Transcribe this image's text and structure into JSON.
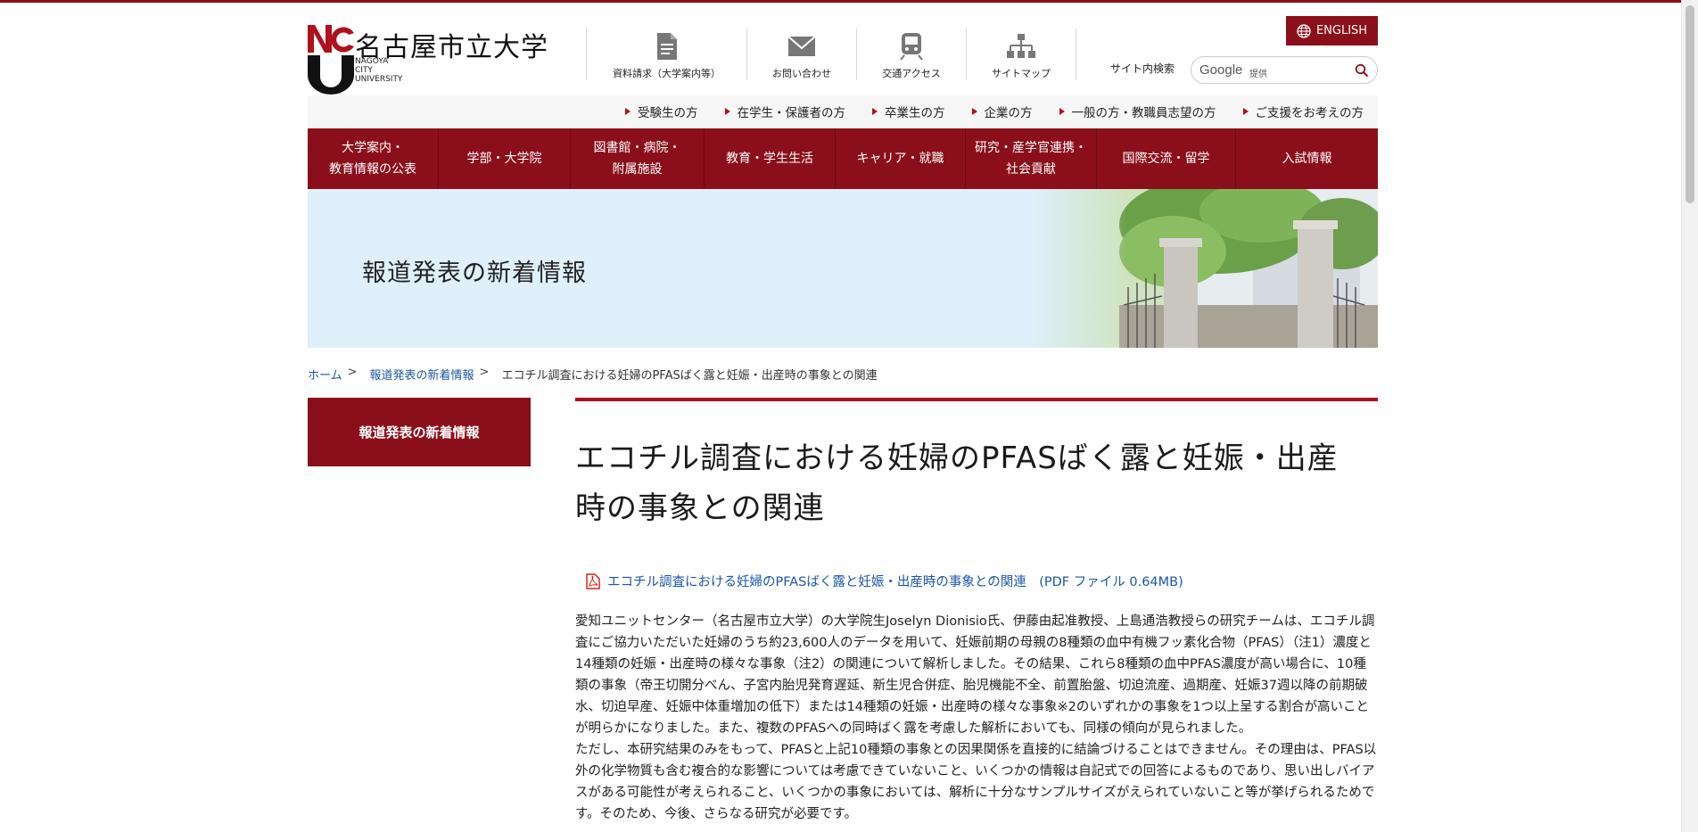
{
  "header": {
    "logo_jp": "名古屋市立大学",
    "logo_en_lines": [
      "NAGOYA",
      "CITY",
      "UNIVERSITY"
    ],
    "english_label": "ENGLISH",
    "util": [
      {
        "label": "資料請求（大学案内等）",
        "icon": "document-icon"
      },
      {
        "label": "お問い合わせ",
        "icon": "mail-icon"
      },
      {
        "label": "交通アクセス",
        "icon": "train-icon"
      },
      {
        "label": "サイトマップ",
        "icon": "sitemap-icon"
      }
    ],
    "search_label": "サイト内検索",
    "search_google": "Google",
    "search_provided": "提供"
  },
  "audience_nav": [
    "受験生の方",
    "在学生・保護者の方",
    "卒業生の方",
    "企業の方",
    "一般の方・教職員志望の方",
    "ご支援をお考えの方"
  ],
  "global_nav": [
    {
      "line1": "大学案内・",
      "line2": "教育情報の公表"
    },
    {
      "line1": "学部・大学院",
      "line2": ""
    },
    {
      "line1": "図書館・病院・",
      "line2": "附属施設"
    },
    {
      "line1": "教育・学生生活",
      "line2": ""
    },
    {
      "line1": "キャリア・就職",
      "line2": ""
    },
    {
      "line1": "研究・産学官連携・",
      "line2": "社会貢献"
    },
    {
      "line1": "国際交流・留学",
      "line2": ""
    },
    {
      "line1": "入試情報",
      "line2": ""
    }
  ],
  "hero": {
    "title": "報道発表の新着情報"
  },
  "breadcrumb": {
    "home": "ホーム",
    "section": "報道発表の新着情報",
    "current": "エコチル調査における妊婦のPFASばく露と妊娠・出産時の事象との関連",
    "separator": ">"
  },
  "sidebar": {
    "label": "報道発表の新着情報"
  },
  "article": {
    "title_line1": "エコチル調査における妊婦のPFASばく露と妊娠・出産",
    "title_line2": "時の事象との関連",
    "pdf_link": "エコチル調査における妊婦のPFASばく露と妊娠・出産時の事象との関連　(PDF ファイル 0.64MB)",
    "p1": "愛知ユニットセンター（名古屋市立大学）の大学院生Joselyn Dionisio氏、伊藤由起准教授、上島通浩教授らの研究チームは、エコチル調査にご協力いただいた妊婦のうち約23,600人のデータを用いて、妊娠前期の母親の8種類の血中有機フッ素化合物（PFAS）（注1）濃度と14種類の妊娠・出産時の様々な事象（注2）の関連について解析しました。その結果、これら8種類の血中PFAS濃度が高い場合に、10種類の事象（帝王切開分べん、子宮内胎児発育遅延、新生児合併症、胎児機能不全、前置胎盤、切迫流産、過期産、妊娠37週以降の前期破水、切迫早産、妊娠中体重増加の低下）または14種類の妊娠・出産時の様々な事象※2のいずれかの事象を1つ以上呈する割合が高いことが明らかになりました。また、複数のPFASへの同時ばく露を考慮した解析においても、同様の傾向が見られました。",
    "p2": "ただし、本研究結果のみをもって、PFASと上記10種類の事象との因果関係を直接的に結論づけることはできません。その理由は、PFAS以外の化学物質も含む複合的な影響については考慮できていないこと、いくつかの情報は自記式での回答によるものであり、思い出しバイアスがある可能性が考えられること、いくつかの事象においては、解析に十分なサンプルサイズがえられていないこと等が挙げられるためです。そのため、今後、さらなる研究が必要です。"
  },
  "colors": {
    "brand": "#8b0f1a",
    "link": "#1b57a7",
    "hero_bg": "#dff0fb"
  }
}
